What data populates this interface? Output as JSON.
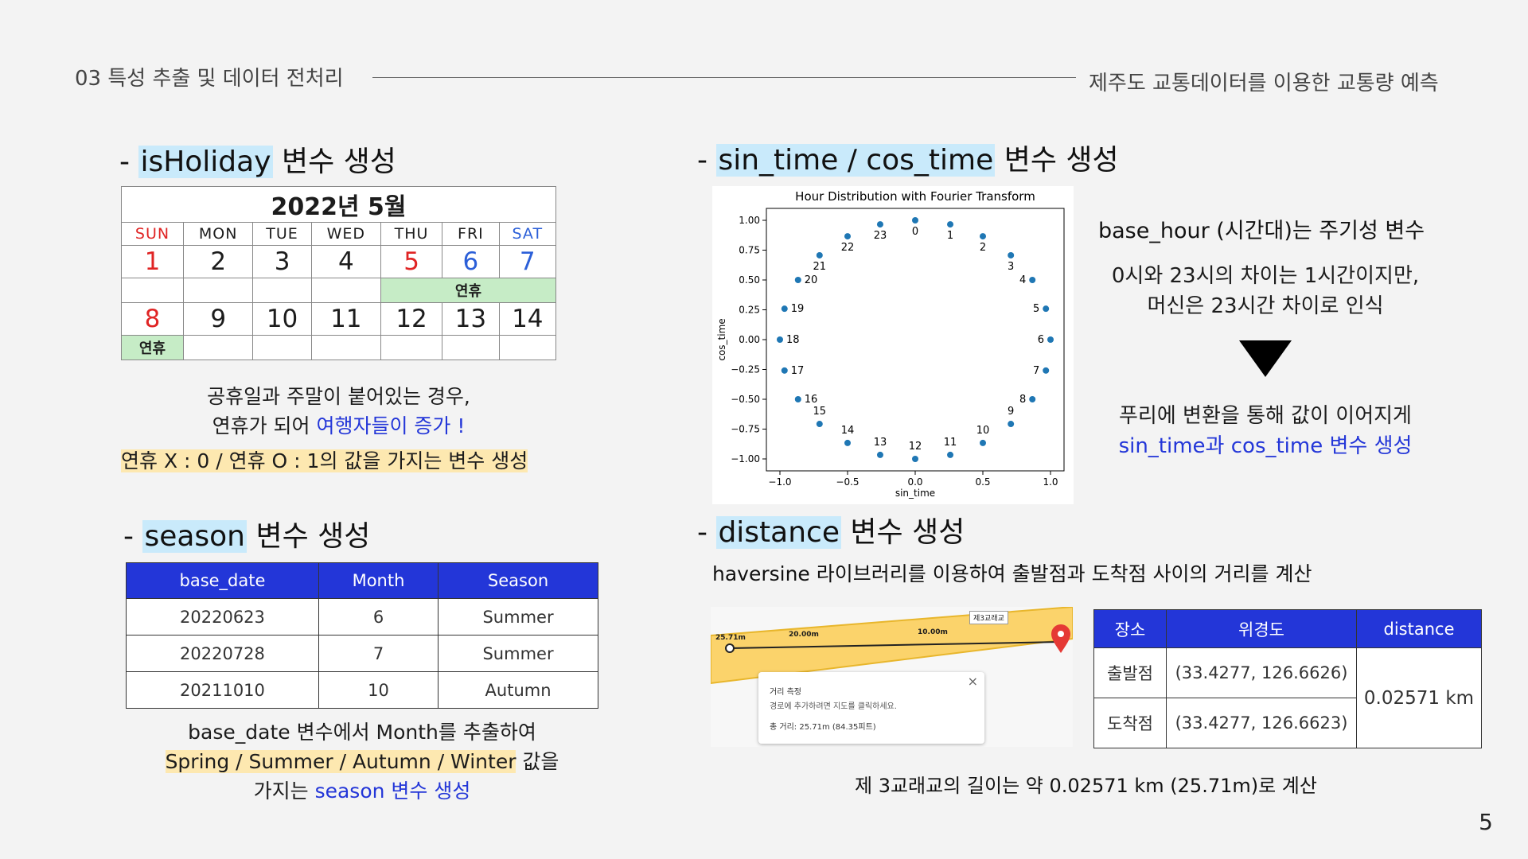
{
  "header": {
    "section_title": "03 특성 추출 및 데이터 전처리",
    "presentation_title": "제주도 교통데이터를 이용한 교통량 예측",
    "page_number": "5"
  },
  "holiday_section": {
    "prefix": "- ",
    "keyword": "isHoliday",
    "suffix": " 변수 생성",
    "calendar": {
      "title": "2022년 5월",
      "weekdays": [
        "SUN",
        "MON",
        "TUE",
        "WED",
        "THU",
        "FRI",
        "SAT"
      ],
      "week1": [
        "1",
        "2",
        "3",
        "4",
        "5",
        "6",
        "7"
      ],
      "week2": [
        "8",
        "9",
        "10",
        "11",
        "12",
        "13",
        "14"
      ],
      "holiday_label": "연휴",
      "colors": {
        "sunday_and_holiday": "#e02424",
        "saturday": "#2b5fd8",
        "holiday_bg": "#c6ecc6"
      }
    },
    "desc_line1": "공휴일과 주말이 붙어있는 경우,",
    "desc_line2_prefix": "연휴가 되어 ",
    "desc_line2_highlight": "여행자들이 증가 !",
    "desc_line3": "연휴 X : 0 / 연휴 O : 1의 값을 가지는 변수 생성"
  },
  "season_section": {
    "prefix": "- ",
    "keyword": "season",
    "suffix": " 변수 생성",
    "table": {
      "headers": [
        "base_date",
        "Month",
        "Season"
      ],
      "rows": [
        [
          "20220623",
          "6",
          "Summer"
        ],
        [
          "20220728",
          "7",
          "Summer"
        ],
        [
          "20211010",
          "10",
          "Autumn"
        ]
      ]
    },
    "desc_line1": "base_date 변수에서 Month를 추출하여",
    "desc_line2_highlight": "Spring / Summer / Autumn / Winter",
    "desc_line2_suffix": " 값을",
    "desc_line3_prefix": "가지는 ",
    "desc_line3_highlight": "season 변수 생성"
  },
  "time_section": {
    "prefix": "- ",
    "keyword": "sin_time / cos_time",
    "suffix": " 변수 생성",
    "explain_title": "base_hour (시간대)는 주기성 변수",
    "explain_line1": "0시와 23시의 차이는 1시간이지만,",
    "explain_line2": "머신은 23시간 차이로 인식",
    "result_line1": "푸리에 변환을 통해 값이 이어지게",
    "result_line2": "sin_time과 cos_time 변수 생성"
  },
  "chart_data": {
    "type": "scatter",
    "title": "Hour Distribution with Fourier Transform",
    "xlabel": "sin_time",
    "ylabel": "cos_time",
    "xlim": [
      -1.1,
      1.1
    ],
    "ylim": [
      -1.1,
      1.1
    ],
    "x_ticks": [
      "−1.0",
      "−0.5",
      "0.0",
      "0.5",
      "1.0"
    ],
    "y_ticks": [
      "1.00",
      "0.75",
      "0.50",
      "0.25",
      "0.00",
      "−0.25",
      "−0.50",
      "−0.75",
      "−1.00"
    ],
    "grid": false,
    "point_color": "#1f77b4",
    "points": [
      {
        "label": "0",
        "x": 0.0,
        "y": 1.0
      },
      {
        "label": "1",
        "x": 0.259,
        "y": 0.966
      },
      {
        "label": "2",
        "x": 0.5,
        "y": 0.866
      },
      {
        "label": "3",
        "x": 0.707,
        "y": 0.707
      },
      {
        "label": "4",
        "x": 0.866,
        "y": 0.5
      },
      {
        "label": "5",
        "x": 0.966,
        "y": 0.259
      },
      {
        "label": "6",
        "x": 1.0,
        "y": 0.0
      },
      {
        "label": "7",
        "x": 0.966,
        "y": -0.259
      },
      {
        "label": "8",
        "x": 0.866,
        "y": -0.5
      },
      {
        "label": "9",
        "x": 0.707,
        "y": -0.707
      },
      {
        "label": "10",
        "x": 0.5,
        "y": -0.866
      },
      {
        "label": "11",
        "x": 0.259,
        "y": -0.966
      },
      {
        "label": "12",
        "x": 0.0,
        "y": -1.0
      },
      {
        "label": "13",
        "x": -0.259,
        "y": -0.966
      },
      {
        "label": "14",
        "x": -0.5,
        "y": -0.866
      },
      {
        "label": "15",
        "x": -0.707,
        "y": -0.707
      },
      {
        "label": "16",
        "x": -0.866,
        "y": -0.5
      },
      {
        "label": "17",
        "x": -0.966,
        "y": -0.259
      },
      {
        "label": "18",
        "x": -1.0,
        "y": 0.0
      },
      {
        "label": "19",
        "x": -0.966,
        "y": 0.259
      },
      {
        "label": "20",
        "x": -0.866,
        "y": 0.5
      },
      {
        "label": "21",
        "x": -0.707,
        "y": 0.707
      },
      {
        "label": "22",
        "x": -0.5,
        "y": 0.866
      },
      {
        "label": "23",
        "x": -0.259,
        "y": 0.966
      }
    ]
  },
  "distance_section": {
    "prefix": "- ",
    "keyword": "distance",
    "suffix": " 변수 생성",
    "subtitle": "haversine 라이브러리를 이용하여 출발점과 도착점 사이의 거리를 계산",
    "map": {
      "label_start": "25.71m",
      "label_20": "20.00m",
      "label_10": "10.00m",
      "bridge_label": "제3교래교",
      "popup_title": "거리 측정",
      "popup_hint": "경로에 추가하려면 지도를 클릭하세요.",
      "popup_total": "총 거리: 25.71m (84.35피트)",
      "close_symbol": "×"
    },
    "table": {
      "headers": [
        "장소",
        "위경도",
        "distance"
      ],
      "rows": [
        [
          "출발점",
          "(33.4277, 126.6626)"
        ],
        [
          "도착점",
          "(33.4277, 126.6623)"
        ]
      ],
      "distance_value": "0.02571 km"
    },
    "conclusion": "제 3교래교의 길이는 약 0.02571 km (25.71m)로 계산"
  }
}
